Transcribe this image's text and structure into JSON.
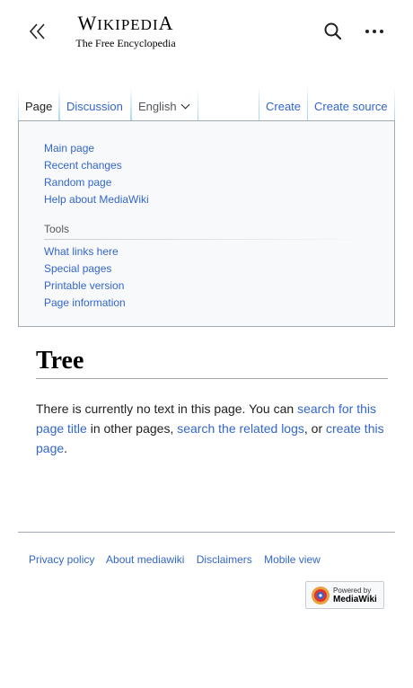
{
  "header": {
    "menu_icon": "double-chevron-left-icon",
    "logo_word_first": "W",
    "logo_word_middle": "IKIPEDI",
    "logo_word_last": "A",
    "logo_tagline": "The Free Encyclopedia",
    "search_icon": "search-icon",
    "more_icon": "ellipsis-icon"
  },
  "tabs": {
    "page": "Page",
    "discussion": "Discussion",
    "language": "English",
    "create": "Create",
    "create_source": "Create source"
  },
  "nav": {
    "main_items": [
      "Main page",
      "Recent changes",
      "Random page",
      "Help about MediaWiki"
    ],
    "tools_heading": "Tools",
    "tools_items": [
      "What links here",
      "Special pages",
      "Printable version",
      "Page information"
    ]
  },
  "content": {
    "title": "Tree",
    "text_1": "There is currently no text in this page. You can ",
    "link_search": "search for this page title",
    "text_2": " in other pages, ",
    "link_logs": "search the related logs",
    "text_3": ", or ",
    "link_create": "create this page",
    "text_4": "."
  },
  "footer": {
    "links": [
      "Privacy policy",
      "About mediawiki",
      "Disclaimers",
      "Mobile view"
    ],
    "powered_small": "Powered by",
    "powered_big": "MediaWiki"
  },
  "colors": {
    "link": "#3366cc",
    "text": "#202122",
    "border": "#a2a9b1"
  }
}
